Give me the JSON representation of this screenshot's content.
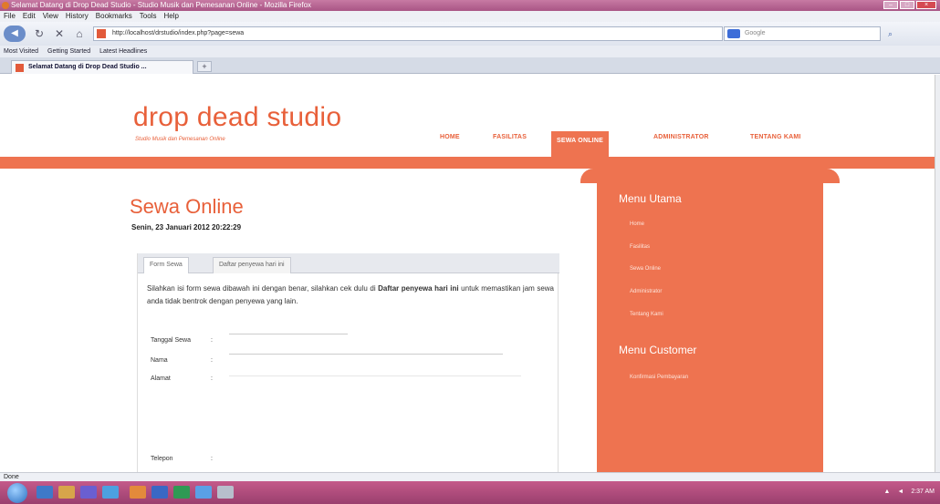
{
  "window": {
    "title": "Selamat Datang di Drop Dead Studio - Studio Musik dan Pemesanan Online - Mozilla Firefox",
    "menu": [
      "File",
      "Edit",
      "View",
      "History",
      "Bookmarks",
      "Tools",
      "Help"
    ]
  },
  "browser": {
    "url": "http://localhost/drstudio/index.php?page=sewa",
    "search_placeholder": "Google",
    "bookmarks": [
      "Most Visited",
      "Getting Started",
      "Latest Headlines"
    ],
    "tab_title": "Selamat Datang di Drop Dead Studio ...",
    "new_tab": "+"
  },
  "site": {
    "brand": "drop dead studio",
    "tagline": "Studio Musik dan Pemesanan Online",
    "nav": [
      "HOME",
      "FASILITAS",
      "SEWA ONLINE",
      "ADMINISTRATOR",
      "TENTANG KAMI"
    ],
    "active_nav": "SEWA ONLINE"
  },
  "content": {
    "title": "Sewa Online",
    "date": "Senin, 23 Januari 2012 20:22:29",
    "form_tabs": [
      "Form Sewa",
      "Daftar penyewa hari ini"
    ],
    "desc_pre": "Silahkan isi form sewa dibawah ini dengan benar, silahkan cek dulu di ",
    "desc_bold": "Daftar penyewa hari ini",
    "desc_post": " untuk memastikan jam sewa anda tidak bentrok dengan penyewa yang lain.",
    "fields": [
      "Tanggal Sewa",
      "Nama",
      "Alamat",
      "Telepon"
    ],
    "colon": ":"
  },
  "sidebar": {
    "heading1": "Menu Utama",
    "menu1": [
      "Home",
      "Fasilitas",
      "Sewa Online",
      "Administrator",
      "Tentang Kami"
    ],
    "heading2": "Menu Customer",
    "menu2": [
      "Konfirmasi Pembayaran"
    ]
  },
  "status": {
    "text": "Done"
  },
  "taskbar": {
    "clock": "2:37 AM"
  }
}
